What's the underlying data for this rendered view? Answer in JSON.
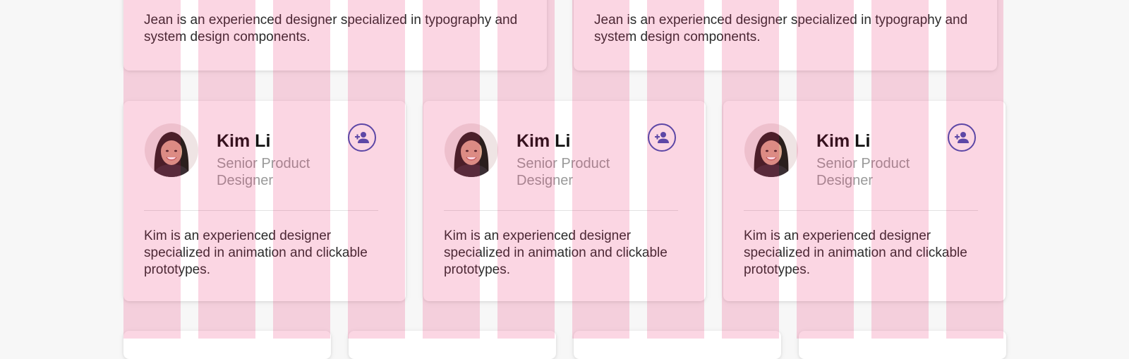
{
  "top_cards": [
    {
      "bio": "Jean is an experienced designer specialized in typography and system design components."
    },
    {
      "bio": "Jean is an experienced designer specialized in typography and system design components."
    }
  ],
  "profiles": [
    {
      "name": "Kim Li",
      "role": "Senior Product Designer",
      "bio": "Kim is an experienced designer specialized in animation and clickable prototypes.",
      "action_icon": "person-add-icon"
    },
    {
      "name": "Kim Li",
      "role": "Senior Product Designer",
      "bio": "Kim is an experienced designer specialized in animation and clickable prototypes.",
      "action_icon": "person-add-icon"
    },
    {
      "name": "Kim Li",
      "role": "Senior Product Designer",
      "bio": "Kim is an experienced designer specialized in animation and clickable prototypes.",
      "action_icon": "person-add-icon"
    }
  ],
  "colors": {
    "accent": "#3f51b5",
    "grid_overlay": "#e91e63",
    "background": "#f7f7f7"
  }
}
